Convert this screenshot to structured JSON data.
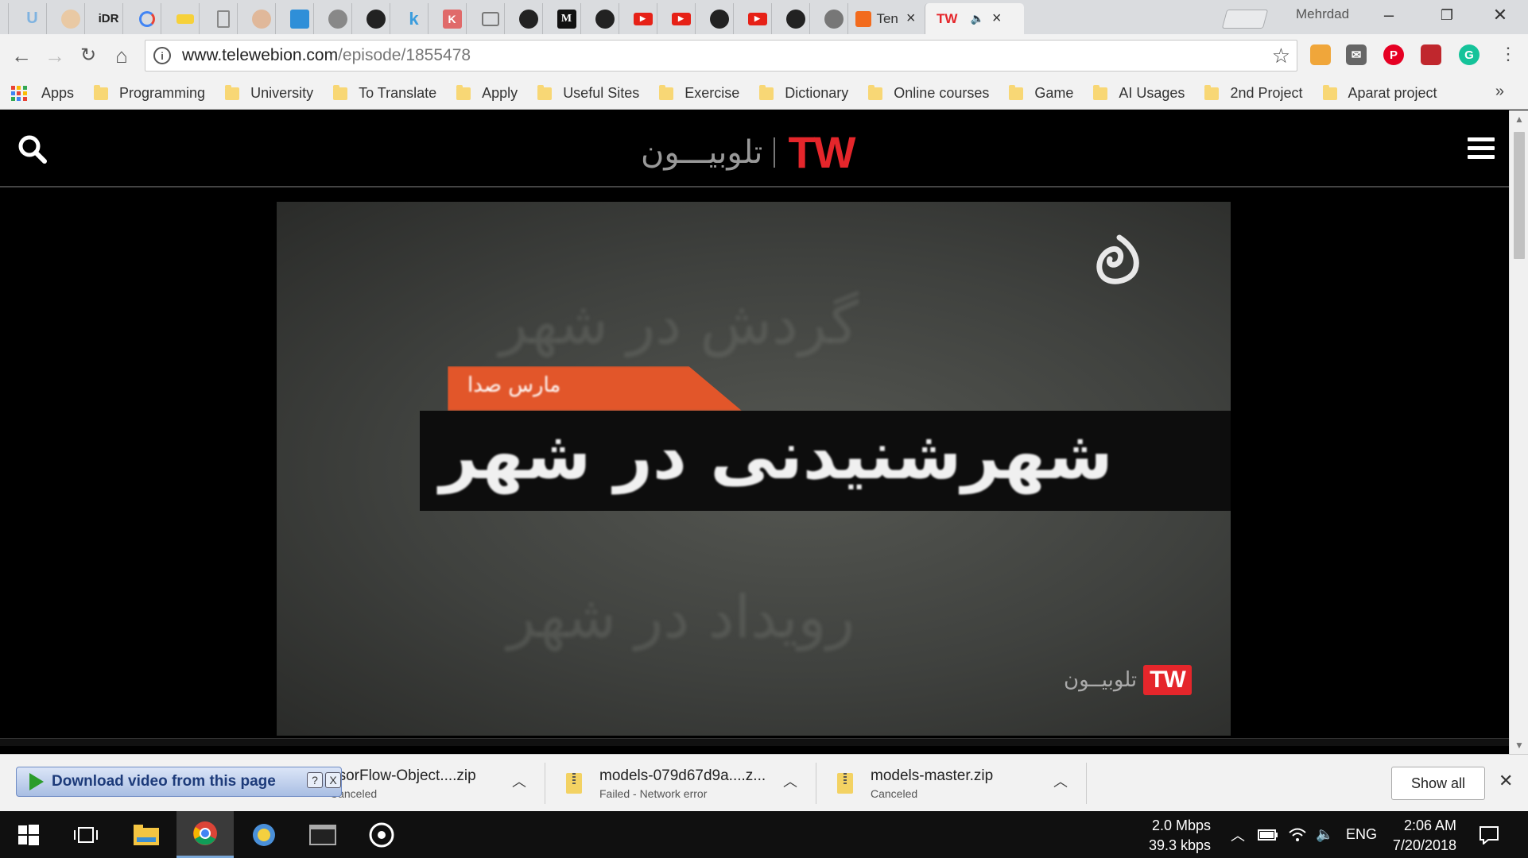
{
  "browser": {
    "profile_name": "Mehrdad",
    "active_tab_title": "TW",
    "partial_tab_title": "Ten",
    "tab_icon_labels": [
      "iDR",
      "k",
      "K",
      "M"
    ],
    "address": {
      "host": "www.telewebion.com",
      "path": "/episode/1855478"
    }
  },
  "bookmarks": {
    "items": [
      "Apps",
      "Programming",
      "University",
      "To Translate",
      "Apply",
      "Useful Sites",
      "Exercise",
      "Dictionary",
      "Online courses",
      "Game",
      "AI Usages",
      "2nd Project",
      "Aparat project"
    ]
  },
  "site": {
    "logo_fa": "تلوبیـــون",
    "logo_tw": "TW"
  },
  "video": {
    "orange_caption": "مارس صدا",
    "title": "شهرشنیدنی در شهر",
    "ghost_line_1": "گردش در شهر",
    "ghost_line_2": "رویداد در شهر",
    "watermark_fa": "تلوبیــون",
    "watermark_tw": "TW"
  },
  "downloads": {
    "overlay_label": "Download video from this page",
    "overlay_help": "?",
    "overlay_close": "X",
    "items": [
      {
        "name": "nsorFlow-Object....zip",
        "status": "Canceled"
      },
      {
        "name": "models-079d67d9a....z...",
        "status": "Failed - Network error"
      },
      {
        "name": "models-master.zip",
        "status": "Canceled"
      }
    ],
    "show_all": "Show all"
  },
  "taskbar": {
    "net_down": "2.0 Mbps",
    "net_up": "39.3 kbps",
    "language": "ENG",
    "time": "2:06 AM",
    "date": "7/20/2018"
  },
  "colors": {
    "brand_red": "#e5262b",
    "tab_strip": "#dadcdf",
    "toolbar": "#f2f2f2"
  }
}
